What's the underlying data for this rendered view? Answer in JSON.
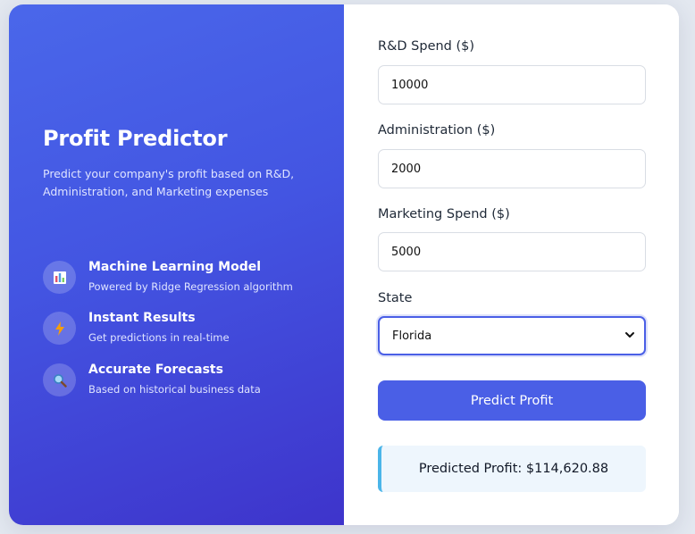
{
  "hero": {
    "title": "Profit Predictor",
    "subtitle": "Predict your company's profit based on R&D, Administration, and Marketing expenses",
    "features": [
      {
        "icon": "bar-chart-icon",
        "title": "Machine Learning Model",
        "desc": "Powered by Ridge Regression algorithm"
      },
      {
        "icon": "lightning-icon",
        "title": "Instant Results",
        "desc": "Get predictions in real-time"
      },
      {
        "icon": "magnifier-icon",
        "title": "Accurate Forecasts",
        "desc": "Based on historical business data"
      }
    ]
  },
  "form": {
    "rd": {
      "label": "R&D Spend ($)",
      "value": "10000"
    },
    "admin": {
      "label": "Administration ($)",
      "value": "2000"
    },
    "marketing": {
      "label": "Marketing Spend ($)",
      "value": "5000"
    },
    "state": {
      "label": "State",
      "selected": "Florida"
    },
    "submit_label": "Predict Profit"
  },
  "result": {
    "text": "Predicted Profit: $114,620.88"
  },
  "colors": {
    "accent": "#4a5fe6",
    "gradient_start": "#4a67ea",
    "gradient_end": "#3e34cb",
    "result_border": "#4bb5e9"
  }
}
